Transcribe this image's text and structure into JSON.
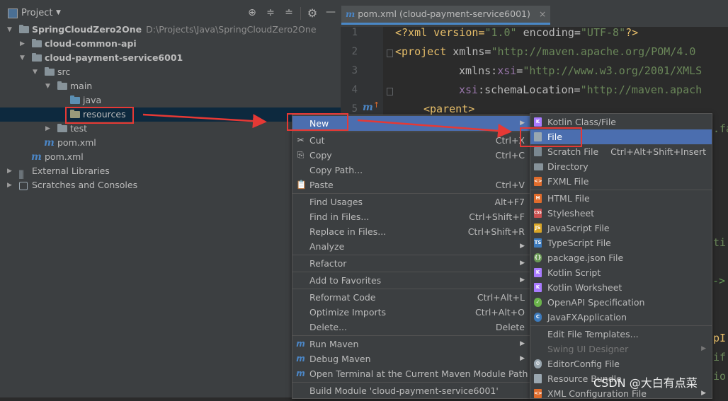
{
  "panel": {
    "title": "Project",
    "title_icon": "project-panel-icon",
    "toolbar_icons": [
      "locate-icon",
      "expand-all-icon",
      "collapse-all-icon",
      "gear-icon",
      "minimize-icon"
    ]
  },
  "tree": [
    {
      "label": "SpringCloudZero2One",
      "hint": "D:\\Projects\\Java\\SpringCloudZero2One",
      "icon": "folder-icon"
    },
    {
      "label": "cloud-common-api",
      "icon": "folder-icon"
    },
    {
      "label": "cloud-payment-service6001",
      "icon": "folder-icon"
    },
    {
      "label": "src",
      "icon": "folder-icon"
    },
    {
      "label": "main",
      "icon": "folder-icon"
    },
    {
      "label": "java",
      "icon": "source-folder-icon"
    },
    {
      "label": "resources",
      "icon": "resources-folder-icon"
    },
    {
      "label": "test",
      "icon": "folder-icon"
    },
    {
      "label": "pom.xml",
      "icon": "maven-icon"
    },
    {
      "label": "pom.xml",
      "icon": "maven-icon"
    },
    {
      "label": "External Libraries",
      "icon": "library-icon"
    },
    {
      "label": "Scratches and Consoles",
      "icon": "scratch-icon"
    }
  ],
  "editor": {
    "tab_label": "pom.xml (cloud-payment-service6001)",
    "line_numbers": [
      "1",
      "2",
      "3",
      "4",
      "5"
    ],
    "lines": [
      {
        "t1": "<?xml version=",
        "t2": "\"1.0\"",
        "t3": " encoding=",
        "t4": "\"UTF-8\"",
        "t5": "?>"
      },
      {
        "t1": "<project ",
        "t2": "xmlns=",
        "t3": "\"http://maven.apache.org/POM/4.0"
      },
      {
        "t1": "xmlns:",
        "t2": "xsi",
        "t3": "=",
        "t4": "\"http://www.w3.org/2001/XMLS"
      },
      {
        "t1": "xsi",
        "t2": ":schemaLocation=",
        "t3": "\"http://maven.apach"
      },
      {
        "t1": "<parent>"
      }
    ],
    "fragments": [
      ".fa",
      "ti",
      "->",
      "pI",
      "if",
      "io"
    ]
  },
  "context_menu": {
    "items": [
      {
        "label": "New",
        "shortcut": "",
        "icon": ""
      },
      {
        "label": "Cut",
        "shortcut": "Ctrl+X",
        "icon": "✂"
      },
      {
        "label": "Copy",
        "shortcut": "Ctrl+C",
        "icon": "⎘"
      },
      {
        "label": "Copy Path...",
        "shortcut": "",
        "icon": ""
      },
      {
        "label": "Paste",
        "shortcut": "Ctrl+V",
        "icon": "📋"
      },
      {
        "label": "Find Usages",
        "shortcut": "Alt+F7",
        "icon": ""
      },
      {
        "label": "Find in Files...",
        "shortcut": "Ctrl+Shift+F",
        "icon": ""
      },
      {
        "label": "Replace in Files...",
        "shortcut": "Ctrl+Shift+R",
        "icon": ""
      },
      {
        "label": "Analyze",
        "shortcut": "",
        "icon": ""
      },
      {
        "label": "Refactor",
        "shortcut": "",
        "icon": ""
      },
      {
        "label": "Add to Favorites",
        "shortcut": "",
        "icon": ""
      },
      {
        "label": "Reformat Code",
        "shortcut": "Ctrl+Alt+L",
        "icon": ""
      },
      {
        "label": "Optimize Imports",
        "shortcut": "Ctrl+Alt+O",
        "icon": ""
      },
      {
        "label": "Delete...",
        "shortcut": "Delete",
        "icon": ""
      },
      {
        "label": "Run Maven",
        "shortcut": "",
        "icon": "maven-run-icon"
      },
      {
        "label": "Debug Maven",
        "shortcut": "",
        "icon": "maven-debug-icon"
      },
      {
        "label": "Open Terminal at the Current Maven Module Path",
        "shortcut": "",
        "icon": "maven-terminal-icon"
      },
      {
        "label": "Build Module 'cloud-payment-service6001'",
        "shortcut": "",
        "icon": ""
      }
    ]
  },
  "submenu": {
    "items": [
      {
        "label": "Kotlin Class/File",
        "shortcut": "",
        "icon": "kotlin-icon",
        "color": "#a97bff",
        "tag": "K"
      },
      {
        "label": "File",
        "shortcut": "",
        "icon": "file-icon",
        "color": "#9aa7b0",
        "tag": ""
      },
      {
        "label": "Scratch File",
        "shortcut": "Ctrl+Alt+Shift+Insert",
        "icon": "scratch-file-icon",
        "color": "#9aa7b0",
        "tag": ""
      },
      {
        "label": "Directory",
        "shortcut": "",
        "icon": "directory-icon",
        "color": "#87939a",
        "tag": ""
      },
      {
        "label": "FXML File",
        "shortcut": "",
        "icon": "fxml-icon",
        "color": "#e06c2c",
        "tag": "<>"
      },
      {
        "label": "HTML File",
        "shortcut": "",
        "icon": "html-icon",
        "color": "#e06c2c",
        "tag": "H"
      },
      {
        "label": "Stylesheet",
        "shortcut": "",
        "icon": "css-icon",
        "color": "#c94f4f",
        "tag": "CSS"
      },
      {
        "label": "JavaScript File",
        "shortcut": "",
        "icon": "javascript-icon",
        "color": "#d8a526",
        "tag": "JS"
      },
      {
        "label": "TypeScript File",
        "shortcut": "",
        "icon": "typescript-icon",
        "color": "#3d7bbd",
        "tag": "TS"
      },
      {
        "label": "package.json File",
        "shortcut": "",
        "icon": "package-json-icon",
        "color": "#6a9955",
        "tag": "{}"
      },
      {
        "label": "Kotlin Script",
        "shortcut": "",
        "icon": "kotlin-script-icon",
        "color": "#a97bff",
        "tag": "K"
      },
      {
        "label": "Kotlin Worksheet",
        "shortcut": "",
        "icon": "kotlin-worksheet-icon",
        "color": "#a97bff",
        "tag": "K"
      },
      {
        "label": "OpenAPI Specification",
        "shortcut": "",
        "icon": "openapi-icon",
        "color": "#6bb34b",
        "tag": "✓"
      },
      {
        "label": "JavaFXApplication",
        "shortcut": "",
        "icon": "javafx-icon",
        "color": "#3d7bbd",
        "tag": "C"
      },
      {
        "label": "Edit File Templates...",
        "shortcut": "",
        "icon": "",
        "color": "",
        "tag": ""
      },
      {
        "label": "Swing UI Designer",
        "shortcut": "",
        "icon": "",
        "color": "",
        "tag": ""
      },
      {
        "label": "EditorConfig File",
        "shortcut": "",
        "icon": "editorconfig-icon",
        "color": "#9aa7b0",
        "tag": "⚙"
      },
      {
        "label": "Resource Bundle",
        "shortcut": "",
        "icon": "resource-bundle-icon",
        "color": "#9aa7b0",
        "tag": ""
      },
      {
        "label": "XML Configuration File",
        "shortcut": "",
        "icon": "xml-config-icon",
        "color": "#e06c2c",
        "tag": "<>"
      }
    ]
  },
  "watermark": "CSDN @大白有点菜",
  "colors": {
    "accent": "#4b6eaf",
    "selection": "#0d293e",
    "annotation": "#e53935"
  }
}
